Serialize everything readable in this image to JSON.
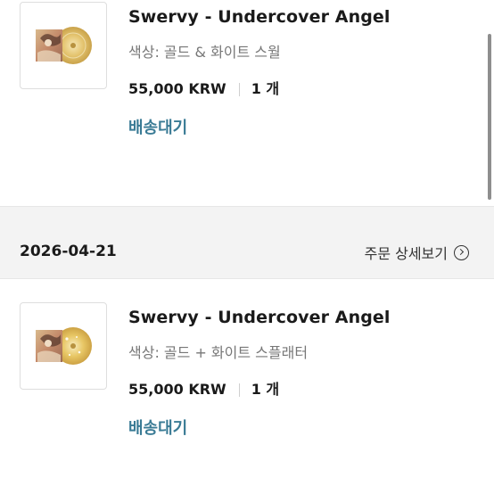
{
  "orders": [
    {
      "item": {
        "title": "Swervy - Undercover Angel",
        "option": "색상: 골드 & 화이트 스월",
        "price": "55,000 KRW",
        "quantity": "1 개",
        "status": "배송대기",
        "image_icon": "album-cover-icon"
      }
    },
    {
      "date": "2026-04-21",
      "detail_link": "주문 상세보기",
      "detail_icon": "chevron-right-circle-icon",
      "item": {
        "title": "Swervy - Undercover Angel",
        "option": "색상: 골드 + 화이트 스플래터",
        "price": "55,000 KRW",
        "quantity": "1 개",
        "status": "배송대기",
        "image_icon": "album-cover-icon"
      }
    }
  ],
  "colors": {
    "status": "#3a7b95",
    "background": "#f3f3f3",
    "vinyl_gold": "#e2c26c"
  }
}
